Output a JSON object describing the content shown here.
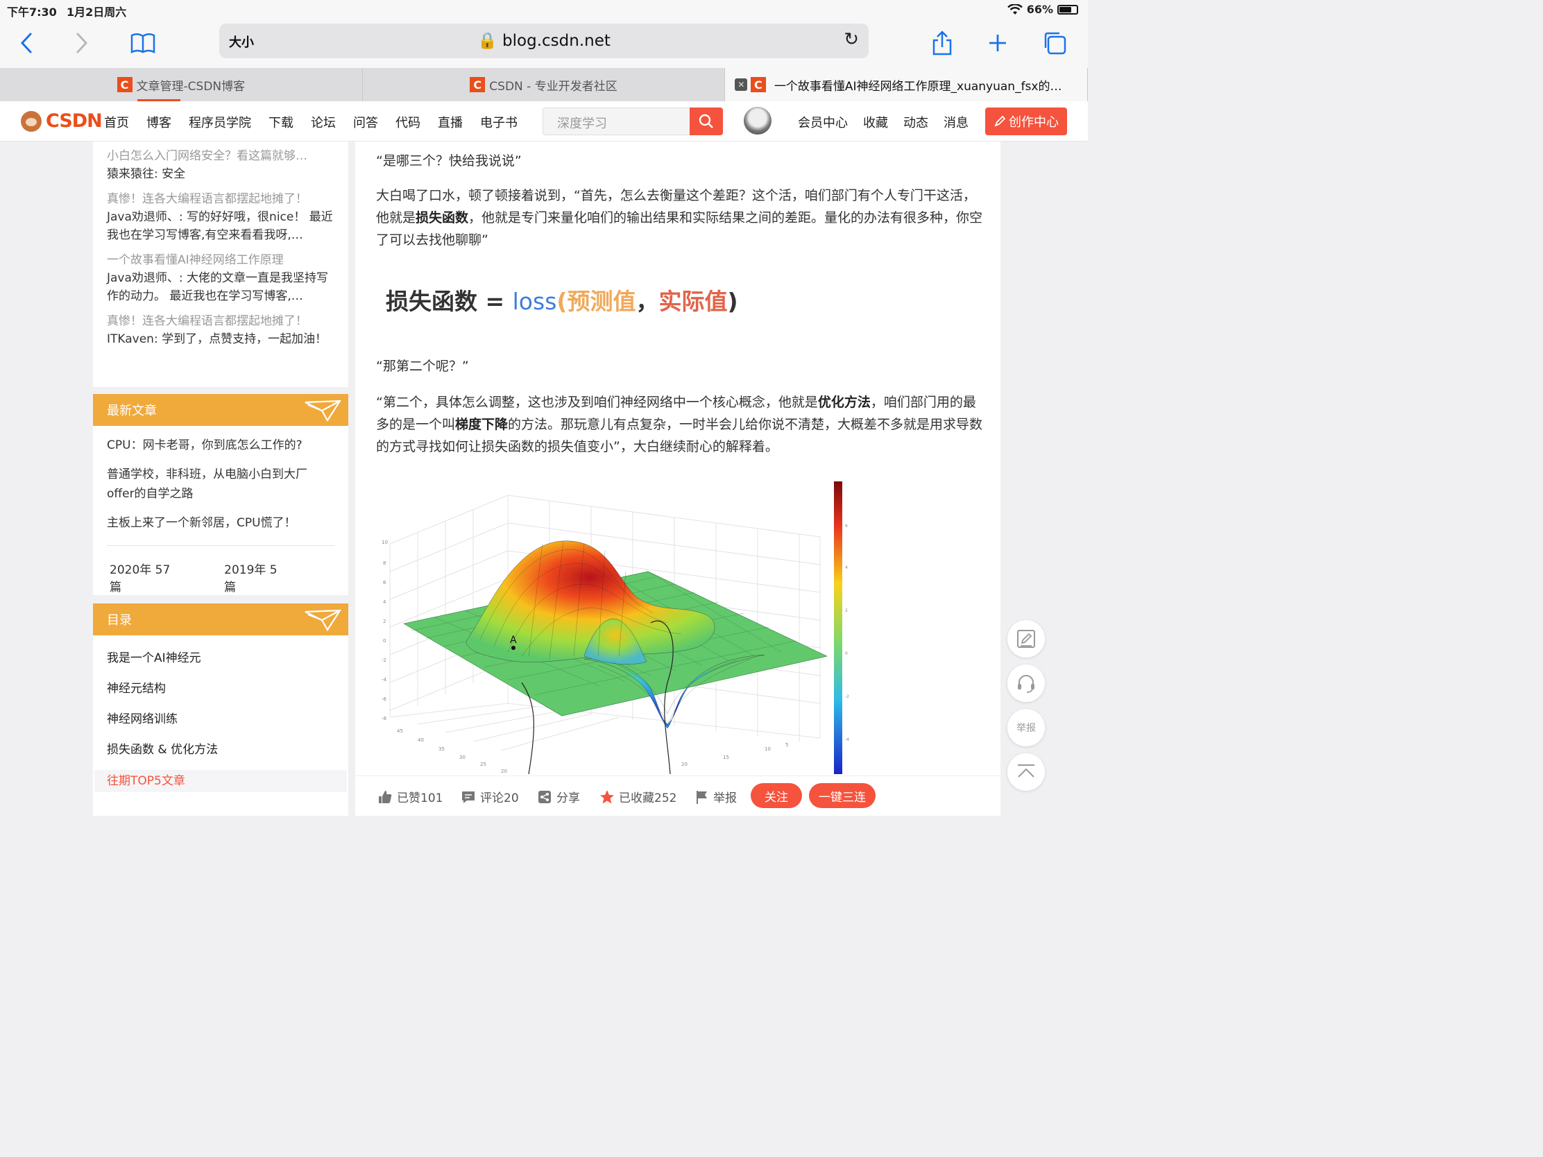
{
  "status": {
    "time": "下午7:30",
    "date": "1月2日周六",
    "battery": "66%",
    "battery_level": 0.66
  },
  "browser": {
    "text_size": "大小",
    "url": "blog.csdn.net",
    "tabs": [
      {
        "favicon": "C",
        "title": "文章管理-CSDN博客"
      },
      {
        "favicon": "C",
        "title": "CSDN - 专业开发者社区"
      },
      {
        "favicon": "C",
        "title": "一个故事看懂AI神经网络工作原理_xuanyuan_fsx的…"
      }
    ]
  },
  "nav": {
    "logo": "CSDN",
    "links": [
      "首页",
      "博客",
      "程序员学院",
      "下载",
      "论坛",
      "问答",
      "代码",
      "直播",
      "电子书"
    ],
    "search_placeholder": "深度学习",
    "right_links": [
      "会员中心",
      "收藏",
      "动态",
      "消息"
    ],
    "create_label": "创作中心"
  },
  "sidebar": {
    "comments": [
      {
        "title": "小白怎么入门网络安全？看这篇就够…",
        "body": "猿来猿往: 安全"
      },
      {
        "title": "真惨！连各大编程语言都摆起地摊了！",
        "body": "Java劝退师、: 写的好好哦，很nice！ 最近我也在学习写博客,有空来看看我呀,…"
      },
      {
        "title": "一个故事看懂AI神经网络工作原理",
        "body": "Java劝退师、: 大佬的文章一直是我坚持写作的动力。 最近我也在学习写博客,…"
      },
      {
        "title": "真惨！连各大编程语言都摆起地摊了！",
        "body": "ITKaven: 学到了，点赞支持，一起加油！"
      }
    ],
    "latest": {
      "heading": "最新文章",
      "items": [
        "CPU：网卡老哥，你到底怎么工作的?",
        "普通学校，非科班，从电脑小白到大厂offer的自学之路",
        "主板上来了一个新邻居，CPU慌了！"
      ],
      "archive": [
        "2020年  57篇",
        "2019年  5篇"
      ]
    },
    "toc": {
      "heading": "目录",
      "items": [
        "我是一个AI神经元",
        "神经元结构",
        "神经网络训练",
        "损失函数 & 优化方法"
      ],
      "highlight": "往期TOP5文章"
    }
  },
  "article": {
    "p1": "“是哪三个？快给我说说”",
    "p2a": "大白喝了口水，顿了顿接着说到，“首先，怎么去衡量这个差距？这个活，咱们部门有个人专门干这活，他就是",
    "p2b": "损失函数",
    "p2c": "，他就是专门来量化咱们的输出结果和实际结果之间的差距。量化的办法有很多种，你空了可以去找他聊聊”",
    "formula": {
      "left": "损失函数 = ",
      "fn": "loss",
      "open": "(",
      "pred": "预测值",
      "comma": "，",
      "real": "实际值",
      "close": ")"
    },
    "p3": "“那第二个呢？”",
    "p4a": "“第二个，具体怎么调整，这也涉及到咱们神经网络中一个核心概念，他就是",
    "p4b": "优化方法",
    "p4c": "，咱们部门用的最多的是一个叫",
    "p4d": "梯度下降",
    "p4e": "的方法。那玩意儿有点复杂，一时半会儿给你说不清楚，大概差不多就是用求导数的方式寻找如何让损失函数的损失值变小”，大白继续耐心的解释着。",
    "plot_point_label": "A"
  },
  "actions": {
    "like": "已赞101",
    "comment": "评论20",
    "share": "分享",
    "collect": "已收藏252",
    "report": "举报",
    "follow": "关注",
    "triple": "一键三连"
  },
  "float": {
    "report": "举报"
  },
  "colors": {
    "brand": "#f5533d",
    "card_head": "#f0a93b",
    "link": "#1a73e8"
  }
}
